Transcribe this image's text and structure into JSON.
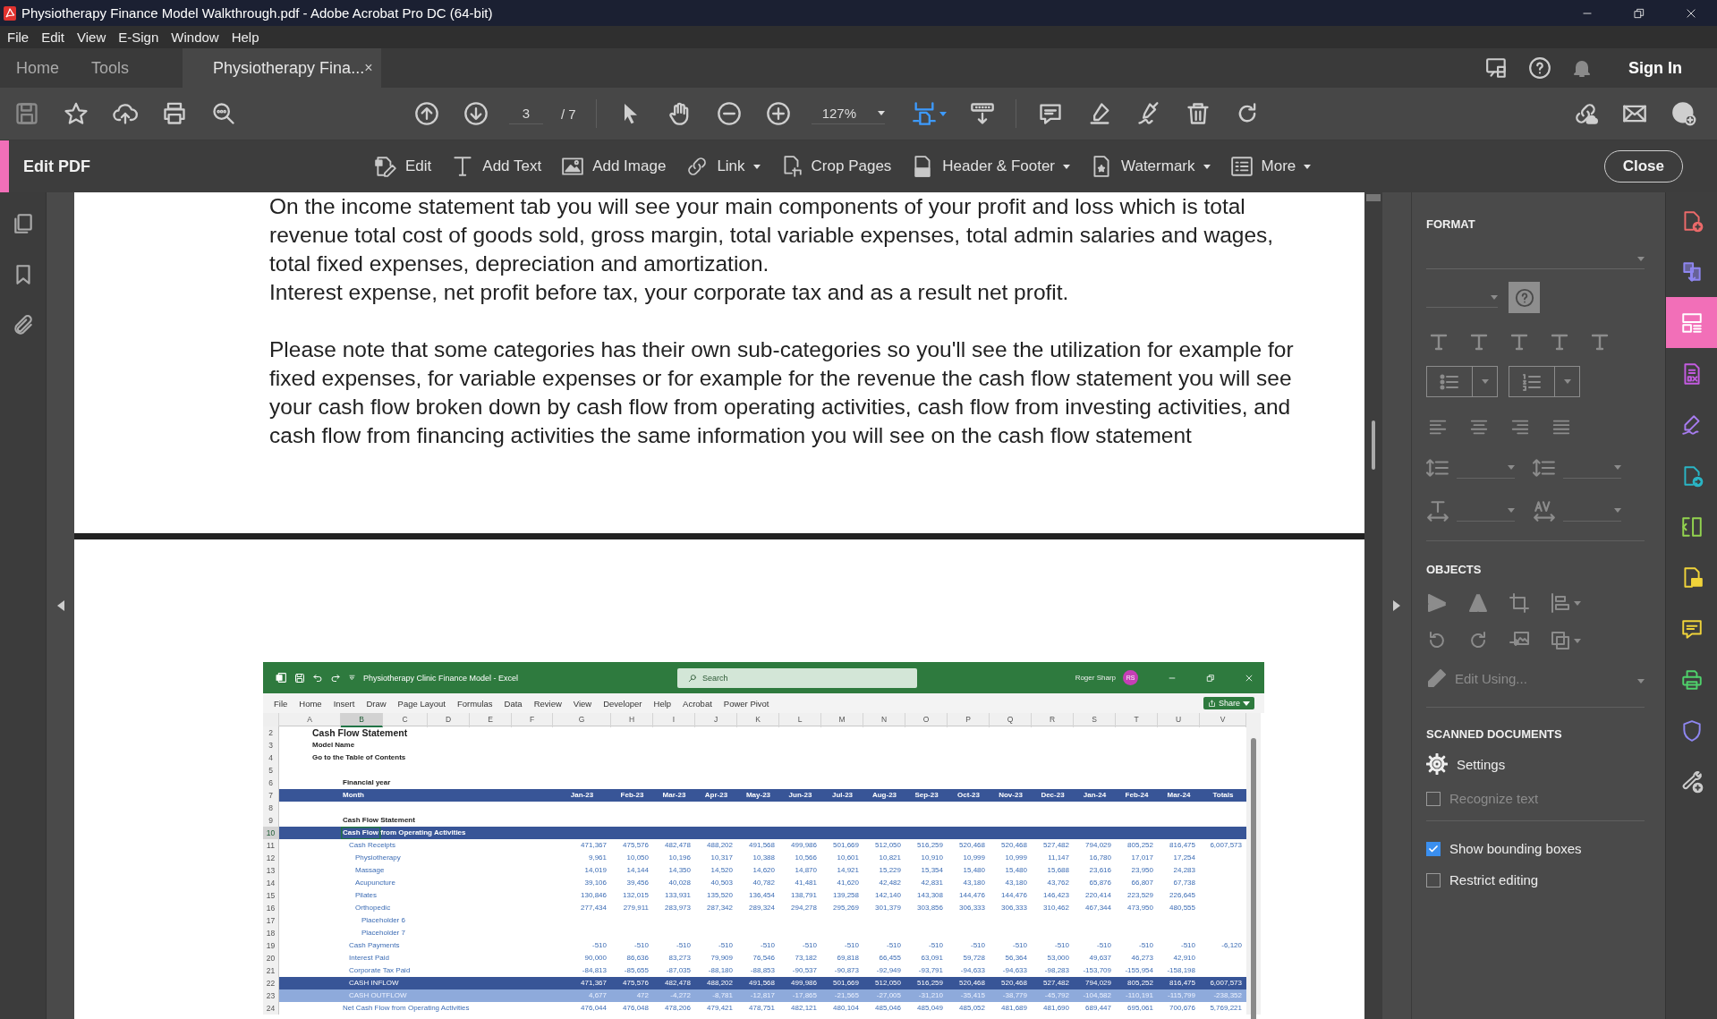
{
  "window": {
    "title": "Physiotherapy Finance Model Walkthrough.pdf - Adobe Acrobat Pro DC (64-bit)"
  },
  "menu": [
    "File",
    "Edit",
    "View",
    "E-Sign",
    "Window",
    "Help"
  ],
  "tabs": [
    {
      "label": "Home",
      "selected": false
    },
    {
      "label": "Tools",
      "selected": false
    },
    {
      "label": "Physiotherapy Fina...",
      "selected": true,
      "close": "×"
    }
  ],
  "sign_in": "Sign In",
  "toolbar": {
    "page": "3",
    "page_total": "/ 7",
    "zoom": "127%"
  },
  "edit_bar": {
    "title": "Edit PDF",
    "close": "Close",
    "tools": [
      {
        "kind": "edit",
        "label": "Edit",
        "dropdown": false
      },
      {
        "kind": "text",
        "label": "Add Text",
        "dropdown": false
      },
      {
        "kind": "image",
        "label": "Add Image",
        "dropdown": false
      },
      {
        "kind": "link",
        "label": "Link",
        "dropdown": true
      },
      {
        "kind": "crop",
        "label": "Crop Pages",
        "dropdown": false
      },
      {
        "kind": "header",
        "label": "Header & Footer",
        "dropdown": true
      },
      {
        "kind": "watermark",
        "label": "Watermark",
        "dropdown": true
      },
      {
        "kind": "more",
        "label": "More",
        "dropdown": true
      }
    ]
  },
  "page_text": [
    [
      "On the income statement tab you will see your main components of your profit and loss which is total",
      "revenue total cost of goods sold, gross margin, total variable expenses, total admin salaries and wages,",
      "total fixed expenses, depreciation and amortization.",
      "Interest expense, net profit before tax, your corporate tax and as a result net profit."
    ],
    [
      "Please note that some categories has their own sub-categories so you'll see the utilization for example for",
      "fixed expenses, for variable expenses or for example for the revenue the cash flow statement you will see",
      "your cash flow broken down by cash flow from operating activities, cash flow from investing activities, and",
      "cash flow from financing activities the same information you will see on the cash flow statement"
    ]
  ],
  "excel": {
    "title": "Physiotherapy Clinic Finance Model  -  Excel",
    "search": {
      "placeholder": "Search"
    },
    "user": "Roger Sharp",
    "avatar": "RS",
    "ribbon": [
      "File",
      "Home",
      "Insert",
      "Draw",
      "Page Layout",
      "Formulas",
      "Data",
      "Review",
      "View",
      "Developer",
      "Help",
      "Acrobat",
      "Power Pivot"
    ],
    "share": "Share",
    "columns": [
      {
        "label": "A",
        "selected": false
      },
      {
        "label": "B",
        "selected": true
      },
      {
        "label": "C",
        "selected": false
      },
      {
        "label": "D",
        "selected": false
      },
      {
        "label": "E",
        "selected": false
      },
      {
        "label": "F",
        "selected": false
      },
      {
        "label": "G",
        "selected": false
      },
      {
        "label": "H",
        "selected": false
      },
      {
        "label": "I",
        "selected": false
      },
      {
        "label": "J",
        "selected": false
      },
      {
        "label": "K",
        "selected": false
      },
      {
        "label": "L",
        "selected": false
      },
      {
        "label": "M",
        "selected": false
      },
      {
        "label": "N",
        "selected": false
      },
      {
        "label": "O",
        "selected": false
      },
      {
        "label": "P",
        "selected": false
      },
      {
        "label": "Q",
        "selected": false
      },
      {
        "label": "R",
        "selected": false
      },
      {
        "label": "S",
        "selected": false
      },
      {
        "label": "T",
        "selected": false
      },
      {
        "label": "U",
        "selected": false
      },
      {
        "label": "V",
        "selected": false
      }
    ],
    "rows": [
      {
        "number": "2",
        "kind": "title",
        "label": "Cash Flow Statement",
        "selected": false
      },
      {
        "number": "3",
        "kind": "bold",
        "label": "Model Name",
        "selected": false
      },
      {
        "number": "4",
        "kind": "bold",
        "label": "Go to the Table of Contents",
        "selected": false
      },
      {
        "number": "5",
        "kind": "blank",
        "selected": false
      },
      {
        "number": "6",
        "kind": "heading",
        "label": "Financial year",
        "selected": false
      },
      {
        "number": "7",
        "kind": "month",
        "label": "Month",
        "selected": false,
        "values": [
          "Jan-23",
          "Feb-23",
          "Mar-23",
          "Apr-23",
          "May-23",
          "Jun-23",
          "Jul-23",
          "Aug-23",
          "Sep-23",
          "Oct-23",
          "Nov-23",
          "Dec-23",
          "Jan-24",
          "Feb-24",
          "Mar-24",
          "Totals"
        ]
      },
      {
        "number": "8",
        "kind": "blank",
        "selected": false
      },
      {
        "number": "9",
        "kind": "heading",
        "label": "Cash Flow Statement",
        "selected": false
      },
      {
        "number": "10",
        "kind": "section",
        "label": "Cash Flow from Operating Activities",
        "selected": true
      },
      {
        "number": "11",
        "kind": "item",
        "label": "Cash Receipts",
        "selected": false,
        "values": [
          "471,367",
          "475,576",
          "482,478",
          "488,202",
          "491,568",
          "499,986",
          "501,669",
          "512,050",
          "516,259",
          "520,468",
          "520,468",
          "527,482",
          "794,029",
          "805,252",
          "816,475",
          "6,007,573"
        ]
      },
      {
        "number": "12",
        "kind": "sub",
        "label": "Physiotherapy",
        "selected": false,
        "values": [
          "9,961",
          "10,050",
          "10,196",
          "10,317",
          "10,388",
          "10,566",
          "10,601",
          "10,821",
          "10,910",
          "10,999",
          "10,999",
          "11,147",
          "16,780",
          "17,017",
          "17,254"
        ]
      },
      {
        "number": "13",
        "kind": "sub",
        "label": "Massage",
        "selected": false,
        "values": [
          "14,019",
          "14,144",
          "14,350",
          "14,520",
          "14,620",
          "14,870",
          "14,921",
          "15,229",
          "15,354",
          "15,480",
          "15,480",
          "15,688",
          "23,616",
          "23,950",
          "24,283"
        ]
      },
      {
        "number": "14",
        "kind": "sub",
        "label": "Acupuncture",
        "selected": false,
        "values": [
          "39,106",
          "39,456",
          "40,028",
          "40,503",
          "40,782",
          "41,481",
          "41,620",
          "42,482",
          "42,831",
          "43,180",
          "43,180",
          "43,762",
          "65,876",
          "66,807",
          "67,738"
        ]
      },
      {
        "number": "15",
        "kind": "sub",
        "label": "Pilates",
        "selected": false,
        "values": [
          "130,846",
          "132,015",
          "133,931",
          "135,520",
          "136,454",
          "138,791",
          "139,258",
          "142,140",
          "143,308",
          "144,476",
          "144,476",
          "146,423",
          "220,414",
          "223,529",
          "226,645"
        ]
      },
      {
        "number": "16",
        "kind": "sub",
        "label": "Orthopedic",
        "selected": false,
        "values": [
          "277,434",
          "279,911",
          "283,973",
          "287,342",
          "289,324",
          "294,278",
          "295,269",
          "301,379",
          "303,856",
          "306,333",
          "306,333",
          "310,462",
          "467,344",
          "473,950",
          "480,555"
        ]
      },
      {
        "number": "17",
        "kind": "subsub",
        "label": "Placeholder 6",
        "selected": false
      },
      {
        "number": "18",
        "kind": "subsub",
        "label": "Placeholder 7",
        "selected": false
      },
      {
        "number": "19",
        "kind": "item",
        "label": "Cash Payments",
        "selected": false,
        "values": [
          "-510",
          "-510",
          "-510",
          "-510",
          "-510",
          "-510",
          "-510",
          "-510",
          "-510",
          "-510",
          "-510",
          "-510",
          "-510",
          "-510",
          "-510",
          "-6,120"
        ]
      },
      {
        "number": "20",
        "kind": "item",
        "label": "Interest Paid",
        "selected": false,
        "values": [
          "90,000",
          "86,636",
          "83,273",
          "79,909",
          "76,546",
          "73,182",
          "69,818",
          "66,455",
          "63,091",
          "59,728",
          "56,364",
          "53,000",
          "49,637",
          "46,273",
          "42,910"
        ]
      },
      {
        "number": "21",
        "kind": "item",
        "label": "Corporate Tax Paid",
        "selected": false,
        "values": [
          "-84,813",
          "-85,655",
          "-87,035",
          "-88,180",
          "-88,853",
          "-90,537",
          "-90,873",
          "-92,949",
          "-93,791",
          "-94,633",
          "-94,633",
          "-98,283",
          "-153,709",
          "-155,954",
          "-158,198"
        ]
      },
      {
        "number": "22",
        "kind": "inflow",
        "label": "CASH INFLOW",
        "selected": false,
        "values": [
          "471,367",
          "475,576",
          "482,478",
          "488,202",
          "491,568",
          "499,986",
          "501,669",
          "512,050",
          "516,259",
          "520,468",
          "520,468",
          "527,482",
          "794,029",
          "805,252",
          "816,475",
          "6,007,573"
        ]
      },
      {
        "number": "23",
        "kind": "outflow",
        "label": "CASH OUTFLOW",
        "selected": false,
        "values": [
          "4,677",
          "472",
          "-4,272",
          "-8,781",
          "-12,817",
          "-17,865",
          "-21,565",
          "-27,005",
          "-31,210",
          "-35,415",
          "-38,779",
          "-45,792",
          "-104,582",
          "-110,191",
          "-115,799",
          "-238,352"
        ]
      },
      {
        "number": "24",
        "kind": "net",
        "label": "Net Cash Flow from Operating Activities",
        "selected": false,
        "values": [
          "476,044",
          "476,048",
          "478,206",
          "479,421",
          "478,751",
          "482,121",
          "480,104",
          "485,046",
          "485,049",
          "485,052",
          "481,689",
          "481,690",
          "689,447",
          "695,061",
          "700,676",
          "5,769,221"
        ]
      }
    ]
  },
  "panel": {
    "format": {
      "title": "FORMAT"
    },
    "objects": {
      "title": "OBJECTS",
      "edit_using": {
        "label": "Edit Using...",
        "disabled": true
      }
    },
    "scanned": {
      "title": "SCANNED DOCUMENTS",
      "settings": "Settings",
      "options": [
        {
          "label": "Recognize text",
          "checked": false,
          "disabled": true
        }
      ]
    },
    "options": [
      {
        "label": "Show bounding boxes",
        "checked": true,
        "disabled": false
      },
      {
        "label": "Restrict editing",
        "checked": false,
        "disabled": false
      }
    ]
  },
  "tool_rail": [
    {
      "kind": "create",
      "selected": false
    },
    {
      "kind": "export",
      "selected": false
    },
    {
      "kind": "organize",
      "selected": true
    },
    {
      "kind": "redact",
      "selected": false
    },
    {
      "kind": "sign",
      "selected": false
    },
    {
      "kind": "send",
      "selected": false
    },
    {
      "kind": "compare",
      "selected": false
    },
    {
      "kind": "review",
      "selected": false
    },
    {
      "kind": "comment",
      "selected": false
    },
    {
      "kind": "print",
      "selected": false
    },
    {
      "kind": "protect",
      "selected": false
    },
    {
      "kind": "tools",
      "selected": false
    }
  ]
}
